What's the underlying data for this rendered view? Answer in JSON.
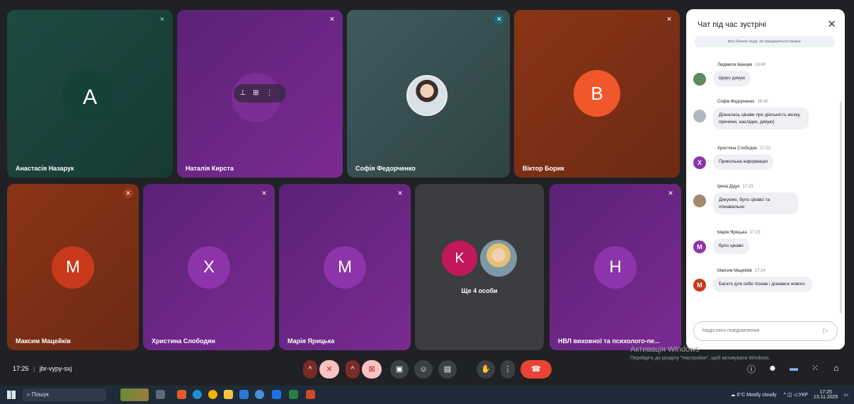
{
  "tiles_top": [
    {
      "name": "Анастасія Назарук",
      "initial": "A",
      "bg": "#1e4a42",
      "avatar_color": "#154139"
    },
    {
      "name": "Наталія Кирста",
      "initial": "",
      "bg": "#6a2786",
      "avatar_color": "#7b2f96"
    },
    {
      "name": "Софія Федорченко",
      "initial": "",
      "bg": "#3f5a5d",
      "avatar_color": ""
    },
    {
      "name": "Віктор Борик",
      "initial": "B",
      "bg": "#7c3016",
      "avatar_color": "#f0572a"
    }
  ],
  "tiles_bottom": [
    {
      "name": "Максим Мацейків",
      "initial": "M",
      "bg": "#7c3016",
      "avatar_color": "#c9391b"
    },
    {
      "name": "Христина Слободян",
      "initial": "X",
      "bg": "#6a2786",
      "avatar_color": "#8e34aa"
    },
    {
      "name": "Марія Ярицька",
      "initial": "M",
      "bg": "#6a2786",
      "avatar_color": "#8e34aa"
    },
    {
      "name": "Ще 4 особи",
      "initial": "K",
      "bg": "#3c3d40",
      "avatar_color": "#c2185b"
    },
    {
      "name": "НВЛ виховної та психолого-пе...",
      "initial": "H",
      "bg": "#6a2786",
      "avatar_color": "#8e34aa"
    }
  ],
  "chat": {
    "title": "Чат під час зустрічі",
    "notice": "його бачили люди, які приєднаються пізніше.",
    "messages": [
      {
        "author": "Людмила Іванцев",
        "time": "16:40",
        "text": "Щиро дякую",
        "avatar": "",
        "color": "#5d8a5e"
      },
      {
        "author": "Софія Федорченко",
        "time": "16:42",
        "text": "Дізналась цікаве про діяльність мозку, причини, наслідки, дякую)",
        "avatar": "",
        "color": "#b0b8bd"
      },
      {
        "author": "Христина Слободян",
        "time": "17:23",
        "text": "Прикольна інформація",
        "avatar": "X",
        "color": "#8e34aa"
      },
      {
        "author": "Ірина Дідух",
        "time": "17:23",
        "text": "Дякуємо, було цікаво та пізнавально",
        "avatar": "",
        "color": "#a38a6d"
      },
      {
        "author": "Марія Ярицька",
        "time": "17:23",
        "text": "було цікаво",
        "avatar": "M",
        "color": "#8e34aa"
      },
      {
        "author": "Максим Мацейків",
        "time": "17:24",
        "text": "Багато для себе пізнав і дізнався нового",
        "avatar": "M",
        "color": "#c9391b"
      }
    ],
    "input_placeholder": "Надіслати повідомлення"
  },
  "meeting": {
    "time": "17:25",
    "code": "jbr-vypy-sxj"
  },
  "watermark": {
    "line1": "Активація Windows",
    "line2": "Перейдіть до розділу \"Настройки\", щоб активувати Windows."
  },
  "taskbar": {
    "search_placeholder": "Пошук",
    "weather": "6°C Mostly cloudy",
    "lang": "УКР",
    "clock_time": "17:25",
    "clock_date": "13.11.2025"
  },
  "colors": {
    "accent_red": "#ea4335",
    "panel_bg": "#ffffff",
    "stage_bg": "#202124"
  }
}
